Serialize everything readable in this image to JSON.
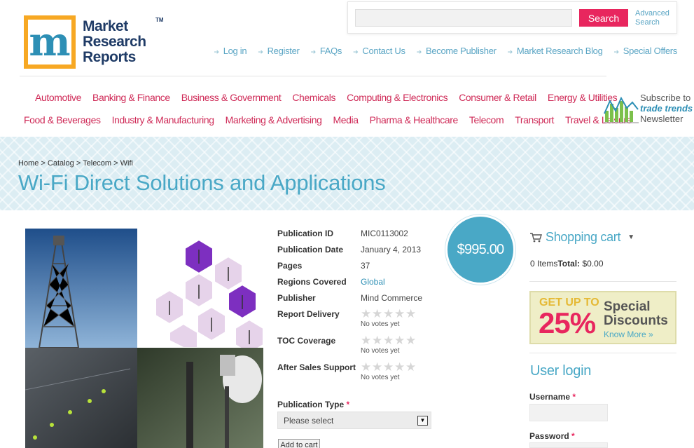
{
  "header": {
    "logo_text_1": "Market",
    "logo_text_2": "Research",
    "logo_text_3": "Reports",
    "logo_tm": "TM",
    "logo_letter": "m",
    "search_button": "Search",
    "advanced_search": "Advanced Search"
  },
  "toplinks": [
    "Log in",
    "Register",
    "FAQs",
    "Contact Us",
    "Become Publisher",
    "Market Research Blog",
    "Special Offers"
  ],
  "categories": {
    "row1": [
      "Automotive",
      "Banking & Finance",
      "Business & Government",
      "Chemicals",
      "Computing & Electronics",
      "Consumer & Retail",
      "Energy & Utilities"
    ],
    "row2": [
      "Food & Beverages",
      "Industry & Manufacturing",
      "Marketing & Advertising",
      "Media",
      "Pharma & Healthcare",
      "Telecom",
      "Transport",
      "Travel & Leisure"
    ]
  },
  "newsletter": {
    "line1": "Subscribe to",
    "line2": "trade trends",
    "line3": "Newsletter"
  },
  "breadcrumb": "Home > Catalog > Telecom > Wifi",
  "page_title": "Wi-Fi Direct Solutions and Applications",
  "details": {
    "publication_id_label": "Publication ID",
    "publication_id": "MIC0113002",
    "publication_date_label": "Publication Date",
    "publication_date": "January 4, 2013",
    "pages_label": "Pages",
    "pages": "37",
    "regions_label": "Regions Covered",
    "regions": "Global",
    "publisher_label": "Publisher",
    "publisher": "Mind Commerce",
    "report_delivery_label": "Report Delivery",
    "toc_label": "TOC Coverage",
    "after_sales_label": "After Sales Support",
    "no_votes": "No votes yet",
    "pubtype_label": "Publication Type",
    "required_mark": "*",
    "select_value": "Please select",
    "add_to_cart": "Add to cart"
  },
  "price": "$995.00",
  "cart": {
    "title": "Shopping cart",
    "items": "0 Items",
    "total_label": "Total:",
    "total": "$0.00"
  },
  "promo": {
    "get_up_to": "GET UP TO",
    "percent": "25%",
    "special": "Special",
    "discounts": "Discounts",
    "know_more": "Know More »"
  },
  "login": {
    "title": "User login",
    "username_label": "Username",
    "password_label": "Password"
  },
  "colors": {
    "accent_blue": "#49a8c6",
    "accent_pink": "#e8265e",
    "category_red": "#cf2a57"
  }
}
